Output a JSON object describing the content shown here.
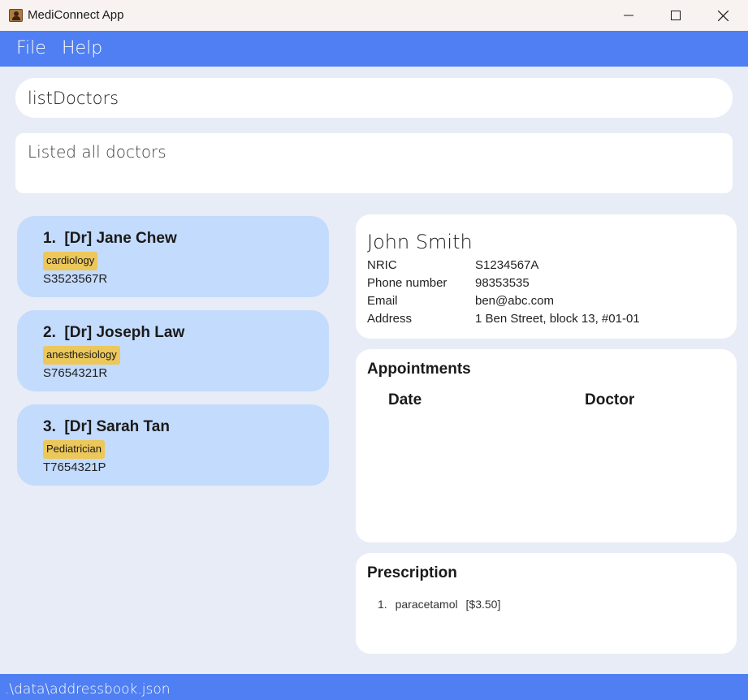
{
  "window": {
    "title": "MediConnect App",
    "icon": "contacts-book-icon"
  },
  "menu": {
    "file_label": "File",
    "help_label": "Help"
  },
  "command": {
    "value": "listDoctors"
  },
  "result": {
    "message": "Listed all doctors"
  },
  "doctors": [
    {
      "index": "1.",
      "name": "[Dr] Jane Chew",
      "tag": "cardiology",
      "nric": "S3523567R"
    },
    {
      "index": "2.",
      "name": "[Dr] Joseph Law",
      "tag": "anesthesiology",
      "nric": "S7654321R"
    },
    {
      "index": "3.",
      "name": "[Dr] Sarah Tan",
      "tag": "Pediatrician",
      "nric": "T7654321P"
    }
  ],
  "patient": {
    "name": "John Smith",
    "fields": [
      {
        "label": "NRIC",
        "value": "S1234567A"
      },
      {
        "label": "Phone number",
        "value": "98353535"
      },
      {
        "label": "Email",
        "value": "ben@abc.com"
      },
      {
        "label": "Address",
        "value": "1 Ben Street, block 13, #01-01"
      }
    ]
  },
  "appointments": {
    "title": "Appointments",
    "columns": [
      "Date",
      "Doctor"
    ],
    "rows": []
  },
  "prescription": {
    "title": "Prescription",
    "items": [
      {
        "index": "1.",
        "name": "paracetamol",
        "price": "[$3.50]"
      }
    ]
  },
  "status": {
    "path": ".\\data\\addressbook.json"
  },
  "colors": {
    "accent": "#4f7ff2",
    "background": "#e8ecf6",
    "card": "#c3dbfc",
    "tag": "#ecc75a"
  }
}
